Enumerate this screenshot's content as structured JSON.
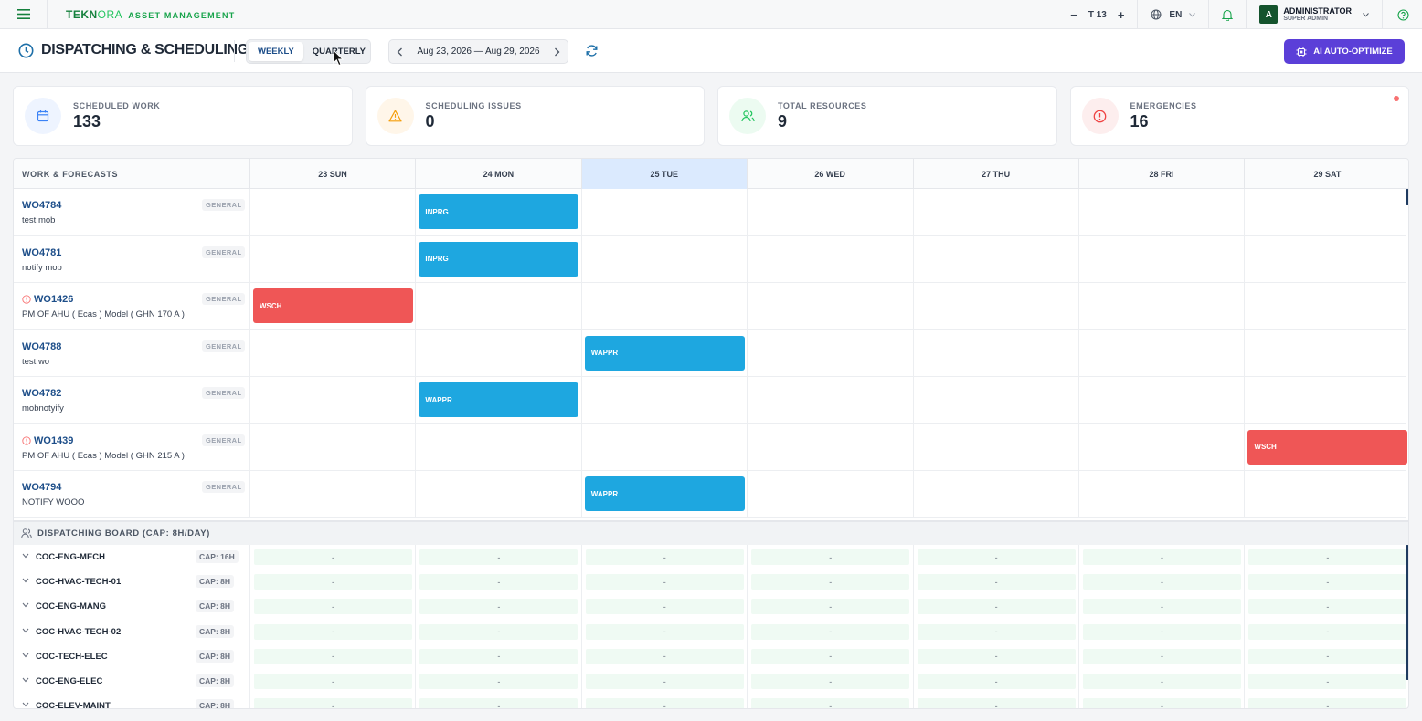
{
  "brand": {
    "logo_a": "TEKN",
    "logo_b": "ORA",
    "subtitle": "ASSET MANAGEMENT"
  },
  "topbar": {
    "font_minus": "−",
    "font_label": "T 13",
    "font_plus": "+",
    "lang": "EN",
    "user_initial": "A",
    "user_name": "ADMINISTRATOR",
    "user_role": "SUPER ADMIN"
  },
  "header": {
    "title": "DISPATCHING & SCHEDULING",
    "view_weekly": "WEEKLY",
    "view_quarterly": "QUARTERLY",
    "date_range": "Aug 23, 2026 — Aug 29, 2026",
    "ai_button": "AI AUTO-OPTIMIZE"
  },
  "stats": [
    {
      "label": "SCHEDULED WORK",
      "value": "133",
      "color": "#3b82f6",
      "bg": "#eef4ff",
      "icon": "calendar-icon"
    },
    {
      "label": "SCHEDULING ISSUES",
      "value": "0",
      "color": "#f59e0b",
      "bg": "#fff6e9",
      "icon": "warning-icon"
    },
    {
      "label": "TOTAL RESOURCES",
      "value": "9",
      "color": "#22c55e",
      "bg": "#ecfbf1",
      "icon": "users-icon"
    },
    {
      "label": "EMERGENCIES",
      "value": "16",
      "color": "#ef4444",
      "bg": "#fdeeee",
      "icon": "alert-icon"
    }
  ],
  "grid": {
    "left_header": "WORK & FORECASTS",
    "days": [
      "23 SUN",
      "24 MON",
      "25 TUE",
      "26 WED",
      "27 THU",
      "28 FRI",
      "29 SAT"
    ],
    "today_index": 2,
    "work_orders": [
      {
        "id": "WO4784",
        "desc": "test mob",
        "tag": "GENERAL",
        "alert": false,
        "day": 1,
        "status": "INPRG",
        "color": "blue"
      },
      {
        "id": "WO4781",
        "desc": "notify mob",
        "tag": "GENERAL",
        "alert": false,
        "day": 1,
        "status": "INPRG",
        "color": "blue"
      },
      {
        "id": "WO1426",
        "desc": "PM OF AHU ( Ecas ) Model ( GHN 170 A )",
        "tag": "GENERAL",
        "alert": true,
        "day": 0,
        "status": "WSCH",
        "color": "red"
      },
      {
        "id": "WO4788",
        "desc": "test wo",
        "tag": "GENERAL",
        "alert": false,
        "day": 2,
        "status": "WAPPR",
        "color": "blue"
      },
      {
        "id": "WO4782",
        "desc": "mobnotyify",
        "tag": "GENERAL",
        "alert": false,
        "day": 1,
        "status": "WAPPR",
        "color": "blue"
      },
      {
        "id": "WO1439",
        "desc": "PM OF AHU ( Ecas ) Model ( GHN 215 A )",
        "tag": "GENERAL",
        "alert": true,
        "day": 6,
        "status": "WSCH",
        "color": "red"
      },
      {
        "id": "WO4794",
        "desc": "NOTIFY WOOO",
        "tag": "GENERAL",
        "alert": false,
        "day": 2,
        "status": "WAPPR",
        "color": "blue"
      }
    ],
    "board_title": "DISPATCHING BOARD (CAP: 8H/DAY)",
    "resources": [
      {
        "name": "COC-ENG-MECH",
        "cap": "CAP: 16H",
        "cells": [
          "-",
          "-",
          "-",
          "-",
          "-",
          "-",
          "-"
        ]
      },
      {
        "name": "COC-HVAC-TECH-01",
        "cap": "CAP: 8H",
        "cells": [
          "-",
          "-",
          "-",
          "-",
          "-",
          "-",
          "-"
        ]
      },
      {
        "name": "COC-ENG-MANG",
        "cap": "CAP: 8H",
        "cells": [
          "-",
          "-",
          "-",
          "-",
          "-",
          "-",
          "-"
        ]
      },
      {
        "name": "COC-HVAC-TECH-02",
        "cap": "CAP: 8H",
        "cells": [
          "-",
          "-",
          "-",
          "-",
          "-",
          "-",
          "-"
        ]
      },
      {
        "name": "COC-TECH-ELEC",
        "cap": "CAP: 8H",
        "cells": [
          "-",
          "-",
          "-",
          "-",
          "-",
          "-",
          "-"
        ]
      },
      {
        "name": "COC-ENG-ELEC",
        "cap": "CAP: 8H",
        "cells": [
          "-",
          "-",
          "-",
          "-",
          "-",
          "-",
          "-"
        ]
      },
      {
        "name": "COC-ELEV-MAINT",
        "cap": "CAP: 8H",
        "cells": [
          "-",
          "-",
          "-",
          "-",
          "-",
          "-",
          "-"
        ]
      }
    ]
  }
}
